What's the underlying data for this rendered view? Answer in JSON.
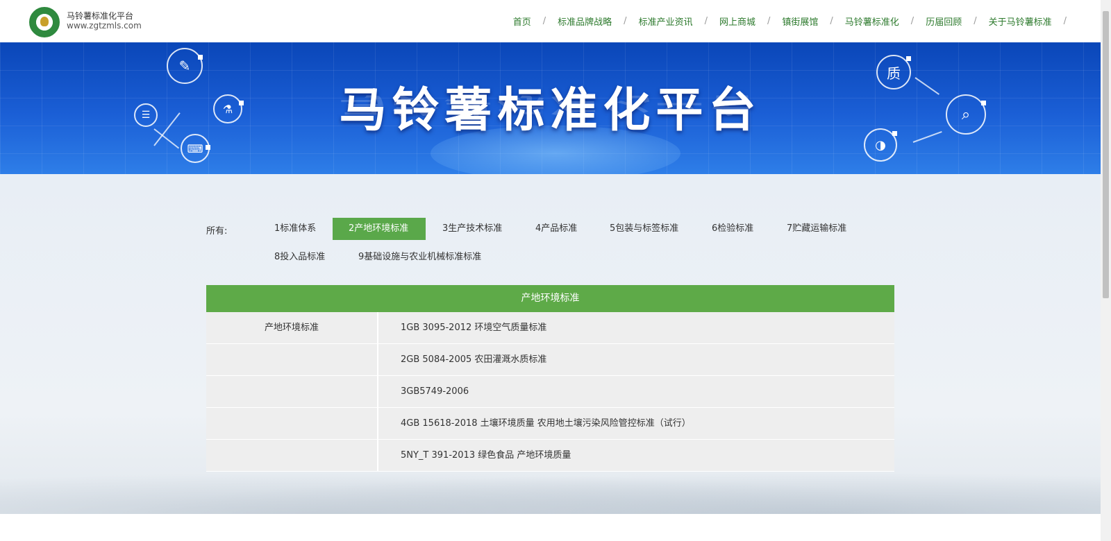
{
  "header": {
    "site_name": "马铃薯标准化平台",
    "site_url": "www.zgtzmls.com",
    "nav": [
      "首页",
      "标准品牌战略",
      "标准产业资讯",
      "网上商城",
      "镇街展馆",
      "马铃薯标准化",
      "历届回顾",
      "关于马铃薯标准"
    ],
    "nav_separator": "/"
  },
  "banner": {
    "title": "马铃薯标准化平台"
  },
  "filter": {
    "label": "所有:",
    "items": [
      "1标准体系",
      "2产地环境标准",
      "3生产技术标准",
      "4产品标准",
      "5包装与标签标准",
      "6检验标准",
      "7贮藏运输标准",
      "8投入品标准",
      "9基础设施与农业机械标准标准"
    ],
    "active": "2产地环境标准"
  },
  "table": {
    "title": "产地环境标准",
    "category": "产地环境标准",
    "rows": [
      "1GB 3095-2012 环境空气质量标准",
      "2GB 5084-2005 农田灌溉水质标准",
      "3GB5749-2006",
      "4GB 15618-2018 土壤环境质量 农用地土壤污染风险管控标准（试行）",
      "5NY_T 391-2013 绿色食品 产地环境质量"
    ]
  },
  "colors": {
    "accent_green": "#5aa84a",
    "nav_green": "#2d7a2d",
    "banner_blue": "#1b5fd6"
  }
}
